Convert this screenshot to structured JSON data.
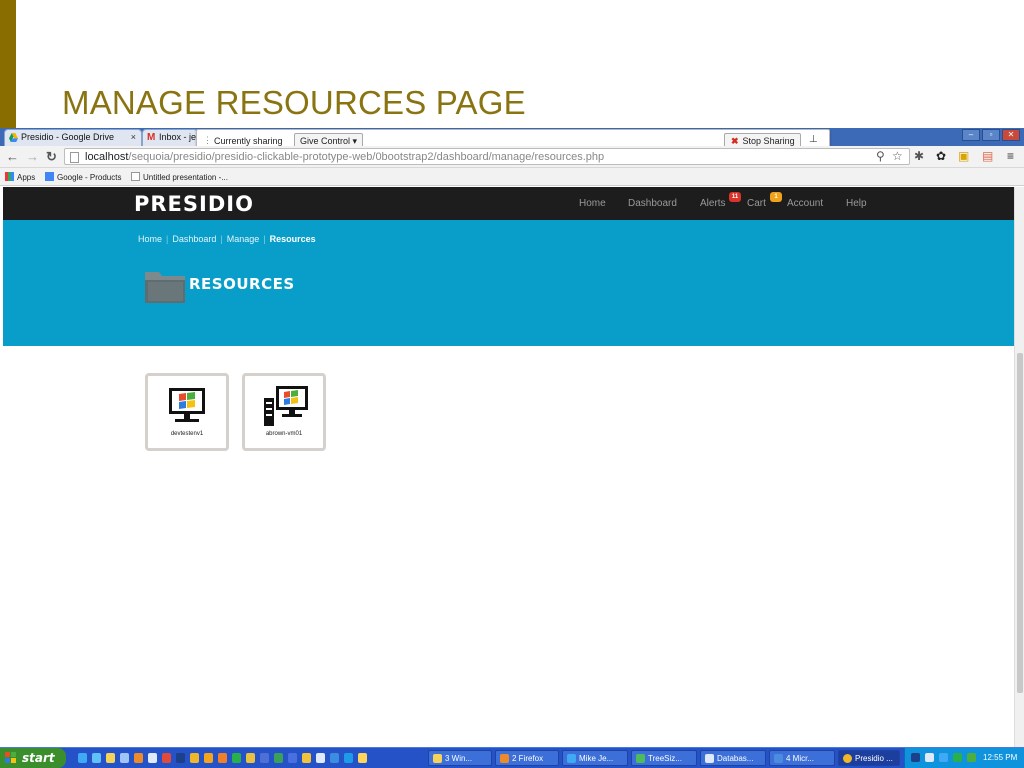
{
  "slide": {
    "title": "MANAGE RESOURCES PAGE"
  },
  "browser": {
    "tabs": [
      {
        "label": "Presidio - Google Drive",
        "close": "×"
      },
      {
        "label": "Inbox - je"
      }
    ],
    "share_bar": {
      "label": "Currently sharing",
      "give_control": "Give Control ▾",
      "stop_sharing": "Stop Sharing"
    },
    "url_host": "localhost",
    "url_path": "/sequoia/presidio/presidio-clickable-prototype-web/0bootstrap2/dashboard/manage/resources.php",
    "bookmarks": [
      "Apps",
      "Google - Products",
      "Untitled presentation -..."
    ]
  },
  "site": {
    "brand": "PRESIDIO",
    "nav": {
      "home": "Home",
      "dashboard": "Dashboard",
      "alerts": "Alerts",
      "alerts_badge": "11",
      "cart": "Cart",
      "cart_badge": "1",
      "account": "Account",
      "help": "Help"
    },
    "breadcrumb": [
      "Home",
      "Dashboard",
      "Manage",
      "Resources"
    ],
    "page_title": "RESOURCES",
    "resources": [
      {
        "name": "devtestenv1",
        "icon": "windows-monitor-icon"
      },
      {
        "name": "abrown-vm01",
        "icon": "windows-server-icon"
      }
    ]
  },
  "taskbar": {
    "start": "start",
    "items": [
      "3 Win...",
      "2 Firefox",
      "Mike Je...",
      "TreeSiz...",
      "Databas...",
      "4 Micr...",
      "Presidio ..."
    ],
    "clock": "12:55 PM"
  },
  "colors": {
    "slide_accent": "#8a7412",
    "site_nav_bg": "#1d1d1d",
    "hero_bg": "#099ec9",
    "taskbar_bg": "#2552c7",
    "start_green": "#3a8f2c"
  }
}
